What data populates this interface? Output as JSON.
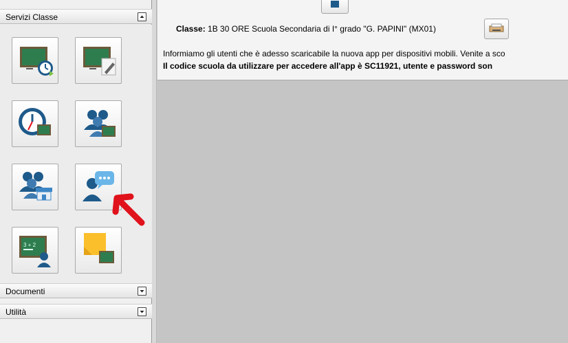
{
  "sidebar": {
    "sections": [
      {
        "label": "Servizi Classe",
        "state": "expanded"
      },
      {
        "label": "Documenti",
        "state": "collapsed"
      },
      {
        "label": "Utilità",
        "state": "collapsed"
      }
    ],
    "tiles": [
      {
        "icon": "blackboard-clock-icon"
      },
      {
        "icon": "blackboard-edit-icon"
      },
      {
        "icon": "clock-blackboard-icon"
      },
      {
        "icon": "students-blackboard-icon"
      },
      {
        "icon": "students-store-icon"
      },
      {
        "icon": "user-chat-icon",
        "annotated": true
      },
      {
        "icon": "blackboard-math-user-icon"
      },
      {
        "icon": "sticky-note-blackboard-icon"
      }
    ]
  },
  "content": {
    "classe_label": "Classe:",
    "classe_value": "1B 30 ORE Scuola Secondaria di I° grado \"G. PAPINI\" (MX01)",
    "info_line1": "Informiamo gli utenti che è adesso scaricabile la nuova app per dispositivi mobili. Venite a sco",
    "info_line2": "Il codice scuola da utilizzare per accedere all'app è SC11921, utente e password son"
  },
  "colors": {
    "blackboard": "#2e7d4f",
    "blackboard_frame": "#6b5a3a",
    "user_blue": "#1e5a8a",
    "annotation_arrow": "#e0121b"
  }
}
